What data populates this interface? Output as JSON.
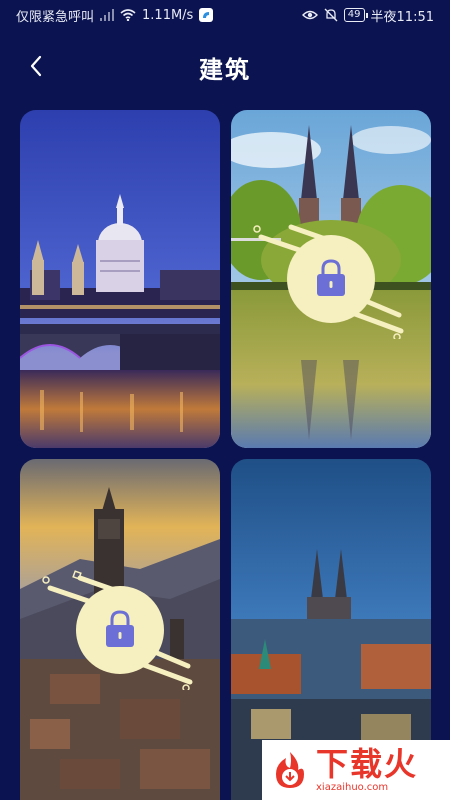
{
  "status_bar": {
    "carrier": "仅限紧急呼叫",
    "net_speed": "1.11M/s",
    "battery": "49",
    "time": "半夜11:51"
  },
  "header": {
    "title": "建筑"
  },
  "cards": [
    {
      "locked": false,
      "icon": "london-cathedral-bridge"
    },
    {
      "locked": true,
      "icon": "twin-spire-church-lake"
    },
    {
      "locked": true,
      "icon": "bell-tower-sunset"
    },
    {
      "locked": false,
      "icon": "gothic-church-city"
    }
  ],
  "watermark": {
    "main": "下载火",
    "sub": "xiazaihuo.com"
  },
  "colors": {
    "background": "#0b1450",
    "lock_circle": "#f6efbf",
    "lock_icon": "#6b6fd6",
    "watermark_red": "#e8362b"
  }
}
